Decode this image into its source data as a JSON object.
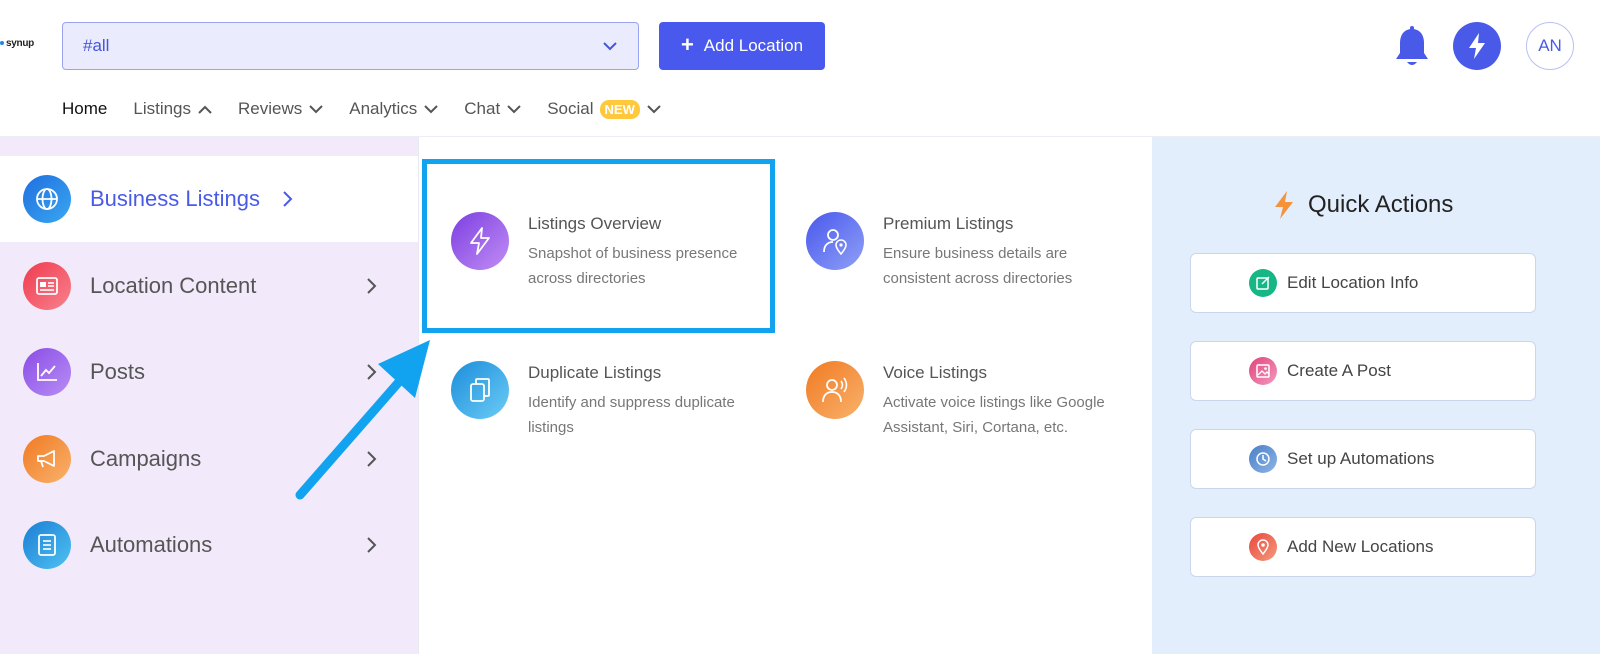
{
  "brand": {
    "logo_text": "synup"
  },
  "header": {
    "location_select": {
      "value": "#all"
    },
    "add_location_label": "Add Location",
    "avatar_initials": "AN"
  },
  "nav": {
    "items": [
      {
        "label": "Home",
        "active": true
      },
      {
        "label": "Listings",
        "expanded": true
      },
      {
        "label": "Reviews"
      },
      {
        "label": "Analytics"
      },
      {
        "label": "Chat"
      },
      {
        "label": "Social",
        "badge": "NEW"
      }
    ]
  },
  "sidebar": {
    "items": [
      {
        "label": "Business Listings",
        "icon": "globe-icon",
        "active": true
      },
      {
        "label": "Location Content",
        "icon": "content-card-icon"
      },
      {
        "label": "Posts",
        "icon": "chart-line-icon"
      },
      {
        "label": "Campaigns",
        "icon": "megaphone-icon"
      },
      {
        "label": "Automations",
        "icon": "document-icon"
      }
    ]
  },
  "submenu": {
    "items": [
      {
        "title": "Listings Overview",
        "desc": "Snapshot of business presence across directories",
        "icon": "bolt-icon"
      },
      {
        "title": "Premium Listings",
        "desc": "Ensure business details are consistent across directories",
        "icon": "user-location-icon"
      },
      {
        "title": "Duplicate Listings",
        "desc": "Identify and suppress duplicate listings",
        "icon": "copy-icon"
      },
      {
        "title": "Voice Listings",
        "desc": "Activate voice listings like Google Assistant, Siri, Cortana, etc.",
        "icon": "voice-user-icon"
      }
    ]
  },
  "quick_actions": {
    "title": "Quick Actions",
    "items": [
      {
        "label": "Edit Location Info",
        "icon": "edit-icon"
      },
      {
        "label": "Create A Post",
        "icon": "image-icon"
      },
      {
        "label": "Set up Automations",
        "icon": "clock-icon"
      },
      {
        "label": "Add New Locations",
        "icon": "location-pin-icon"
      }
    ]
  },
  "colors": {
    "primary": "#4959ee",
    "highlight": "#12a3f0",
    "sidebar_bg": "#f2eafb",
    "quick_actions_bg": "#e3eefc",
    "badge": "#ffc83d"
  }
}
